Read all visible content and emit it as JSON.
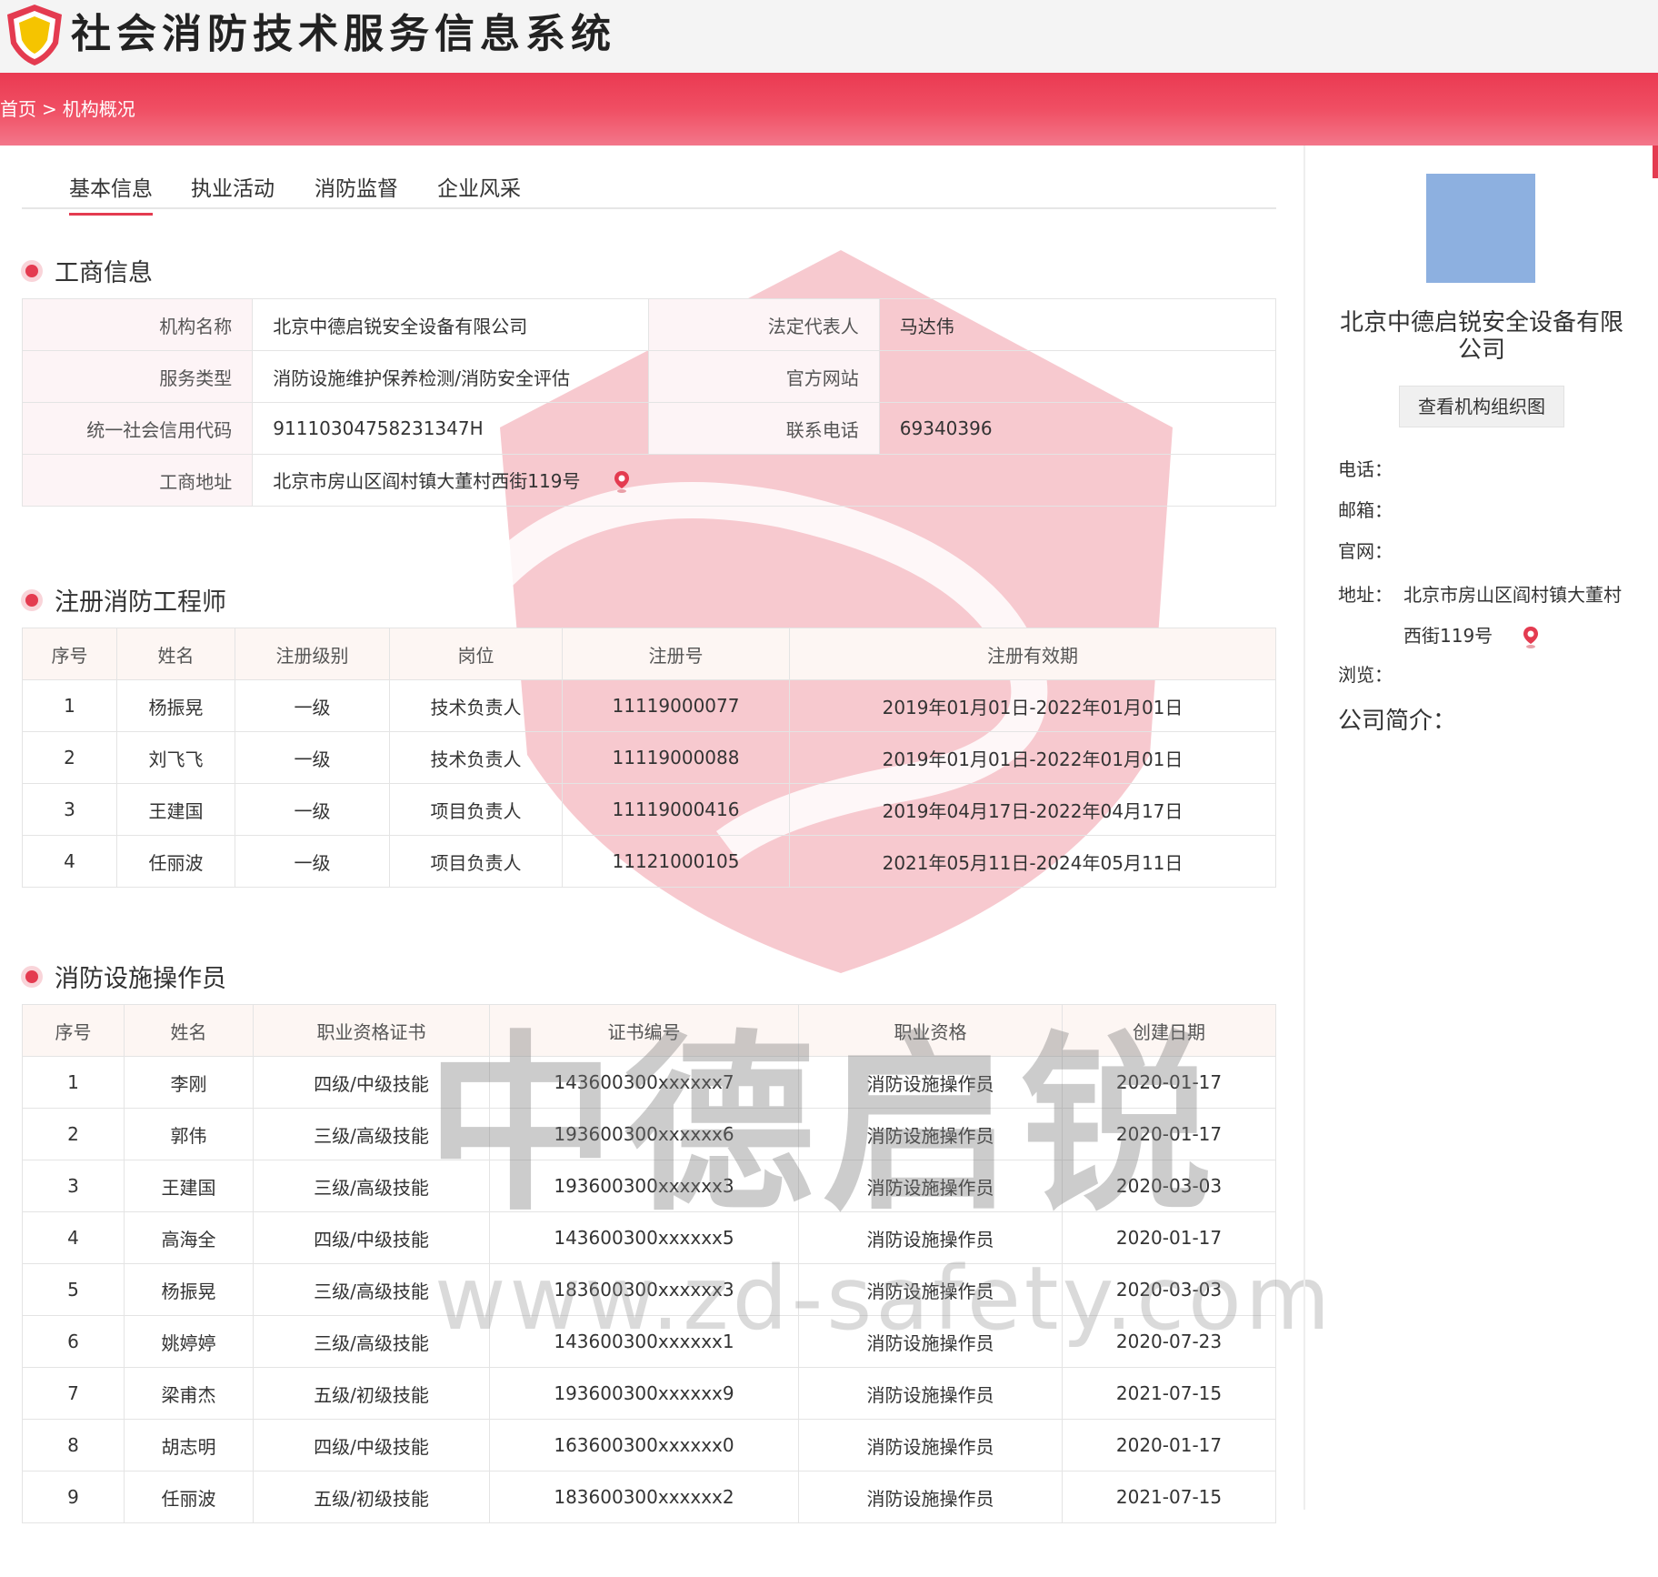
{
  "header": {
    "site_title": "社会消防技术服务信息系统",
    "breadcrumb": {
      "home": "首页",
      "separator": ">",
      "current": "机构概况"
    }
  },
  "tabs": [
    {
      "label": "基本信息",
      "active": true
    },
    {
      "label": "执业活动",
      "active": false
    },
    {
      "label": "消防监督",
      "active": false
    },
    {
      "label": "企业风采",
      "active": false
    }
  ],
  "business_info": {
    "title": "工商信息",
    "rows": [
      {
        "l1": "机构名称",
        "v1": "北京中德启锐安全设备有限公司",
        "l2": "法定代表人",
        "v2": "马达伟"
      },
      {
        "l1": "服务类型",
        "v1": "消防设施维护保养检测/消防安全评估",
        "l2": "官方网站",
        "v2": ""
      },
      {
        "l1": "统一社会信用代码",
        "v1": "91110304758231347H",
        "l2": "联系电话",
        "v2": "69340396"
      }
    ],
    "address_label": "工商地址",
    "address_value": "北京市房山区阎村镇大董村西街119号"
  },
  "engineers": {
    "title": "注册消防工程师",
    "columns": [
      "序号",
      "姓名",
      "注册级别",
      "岗位",
      "注册号",
      "注册有效期"
    ],
    "rows": [
      [
        "1",
        "杨振晃",
        "一级",
        "技术负责人",
        "11119000077",
        "2019年01月01日-2022年01月01日"
      ],
      [
        "2",
        "刘飞飞",
        "一级",
        "技术负责人",
        "11119000088",
        "2019年01月01日-2022年01月01日"
      ],
      [
        "3",
        "王建国",
        "一级",
        "项目负责人",
        "11119000416",
        "2019年04月17日-2022年04月17日"
      ],
      [
        "4",
        "任丽波",
        "一级",
        "项目负责人",
        "11121000105",
        "2021年05月11日-2024年05月11日"
      ]
    ]
  },
  "operators": {
    "title": "消防设施操作员",
    "columns": [
      "序号",
      "姓名",
      "职业资格证书",
      "证书编号",
      "职业资格",
      "创建日期"
    ],
    "rows": [
      [
        "1",
        "李刚",
        "四级/中级技能",
        "143600300xxxxxx7",
        "消防设施操作员",
        "2020-01-17"
      ],
      [
        "2",
        "郭伟",
        "三级/高级技能",
        "193600300xxxxxx6",
        "消防设施操作员",
        "2020-01-17"
      ],
      [
        "3",
        "王建国",
        "三级/高级技能",
        "193600300xxxxxx3",
        "消防设施操作员",
        "2020-03-03"
      ],
      [
        "4",
        "高海全",
        "四级/中级技能",
        "143600300xxxxxx5",
        "消防设施操作员",
        "2020-01-17"
      ],
      [
        "5",
        "杨振晃",
        "三级/高级技能",
        "183600300xxxxxx3",
        "消防设施操作员",
        "2020-03-03"
      ],
      [
        "6",
        "姚婷婷",
        "三级/高级技能",
        "143600300xxxxxx1",
        "消防设施操作员",
        "2020-07-23"
      ],
      [
        "7",
        "梁甫杰",
        "五级/初级技能",
        "193600300xxxxxx9",
        "消防设施操作员",
        "2021-07-15"
      ],
      [
        "8",
        "胡志明",
        "四级/中级技能",
        "163600300xxxxxx0",
        "消防设施操作员",
        "2020-01-17"
      ],
      [
        "9",
        "任丽波",
        "五级/初级技能",
        "183600300xxxxxx2",
        "消防设施操作员",
        "2021-07-15"
      ]
    ]
  },
  "sidebar": {
    "company_name": "北京中德启锐安全设备有限公司",
    "org_chart_button": "查看机构组织图",
    "phone_label": "电话：",
    "email_label": "邮箱：",
    "website_label": "官网：",
    "address_label": "地址：",
    "address_value": "北京市房山区阎村镇大董村西街119号",
    "views_label": "浏览：",
    "intro_label": "公司简介："
  },
  "watermark": {
    "brand": "中德启锐",
    "url": "www.zd-safety.com"
  },
  "colors": {
    "accent": "#e43b50",
    "header_bg": "#f4f4f4",
    "avatar": "#8db0e0"
  }
}
